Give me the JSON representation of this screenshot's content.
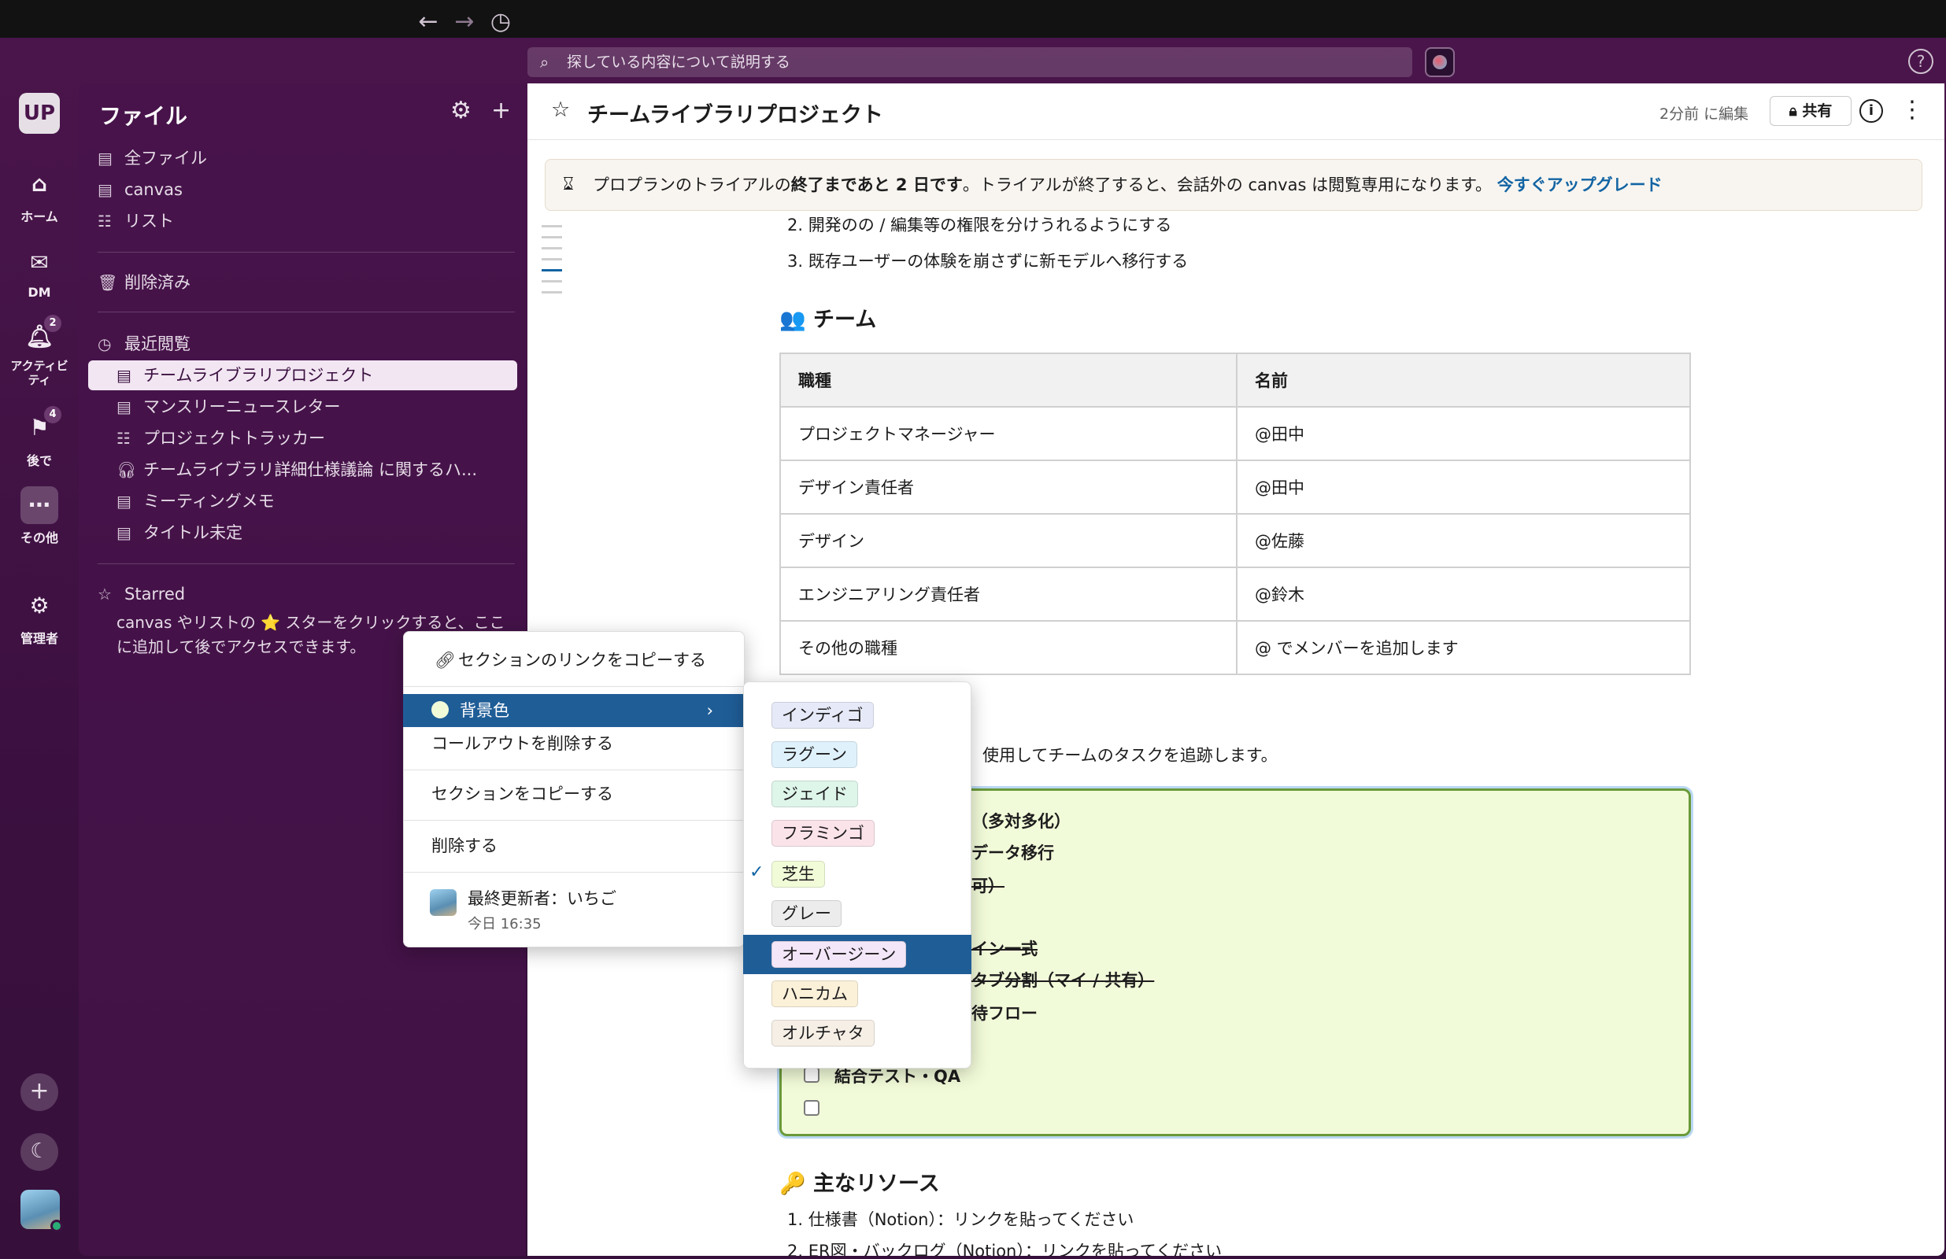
{
  "toolbar": {
    "back_icon": "arrow-left-icon",
    "forward_icon": "arrow-right-icon",
    "history_icon": "clock-icon",
    "search_placeholder": "探している内容について説明する",
    "help_icon": "question-icon"
  },
  "workspace": {
    "initials": "UP"
  },
  "rail": {
    "home": "ホーム",
    "dm": "DM",
    "activity": "アクティビティ",
    "activity_badge": "2",
    "later": "後で",
    "later_badge": "4",
    "more": "その他",
    "admin": "管理者"
  },
  "sidebar": {
    "title": "ファイル",
    "items": [
      {
        "label": "全ファイル",
        "icon": "canvas-icon"
      },
      {
        "label": "canvas",
        "icon": "canvas-icon"
      },
      {
        "label": "リスト",
        "icon": "list-icon"
      }
    ],
    "deleted": "削除済み",
    "recent_heading": "最近閲覧",
    "recent": [
      {
        "label": "チームライブラリプロジェクト",
        "icon": "canvas-icon",
        "selected": true
      },
      {
        "label": "マンスリーニュースレター",
        "icon": "canvas-icon"
      },
      {
        "label": "プロジェクトトラッカー",
        "icon": "list-icon"
      },
      {
        "label": "チームライブラリ詳細仕様議論 に関するハ...",
        "icon": "headphones-icon"
      },
      {
        "label": "ミーティングメモ",
        "icon": "canvas-icon"
      },
      {
        "label": "タイトル未定",
        "icon": "canvas-icon"
      }
    ],
    "starred_heading": "Starred",
    "starred_desc": "canvas やリストの ⭐ スターをクリックすると、ここに追加して後でアクセスできます。"
  },
  "doc": {
    "title": "チームライブラリプロジェクト",
    "edited": "2分前 に編集",
    "share": "共有",
    "banner_pre": "プロプランのトライアルの",
    "banner_bold": "終了まであと 2 日です",
    "banner_post": "。トライアルが終了すると、会話外の canvas は閲覧専用になります。",
    "banner_link": "今すぐアップグレード",
    "partial_item": "2.  開発のの / 編集等の権限を分けうれるようにする",
    "item3": "3.  既存ユーザーの体験を崩さずに新モデルへ移行する",
    "team_heading": "👥 チーム",
    "table_headers": [
      "職種",
      "名前"
    ],
    "table_rows": [
      [
        "プロジェクトマネージャー",
        "@田中"
      ],
      [
        "デザイン責任者",
        "@田中"
      ],
      [
        "デザイン",
        "@佐藤"
      ],
      [
        "エンジニアリング責任者",
        "@鈴木"
      ],
      [
        "その他の職種",
        "@ でメンバーを追加します"
      ]
    ],
    "task_intro": "使用してチームのタスクを追跡します。",
    "tasks": [
      {
        "text": "（多対多化）",
        "strike": false
      },
      {
        "text": "データ移行",
        "strike": false
      },
      {
        "text": "可）",
        "strike": true
      },
      {
        "text": "イン一式",
        "strike": true
      },
      {
        "text": "タブ分割（マイ / 共有）",
        "strike": true
      },
      {
        "text": "待フロー",
        "strike": false
      }
    ],
    "task_qa": "結合テスト・QA",
    "resources_heading": "🔑 主なリソース",
    "res1": "1.  仕様書（Notion）：リンクを貼ってください",
    "res2": "2.  ER図・バックログ（Notion）：リンクを貼ってください"
  },
  "context_menu": {
    "copy_link": "セクションのリンクをコピーする",
    "bg_color": "背景色",
    "remove_callout": "コールアウトを削除する",
    "copy_section": "セクションをコピーする",
    "delete": "削除する",
    "updated_by": "最終更新者：いちご",
    "updated_time": "今日 16:35"
  },
  "color_menu": [
    {
      "label": "インディゴ",
      "color": "#e6eaf8",
      "selected": false,
      "highlighted": false
    },
    {
      "label": "ラグーン",
      "color": "#dff1fb",
      "selected": false,
      "highlighted": false
    },
    {
      "label": "ジェイド",
      "color": "#def5ea",
      "selected": false,
      "highlighted": false
    },
    {
      "label": "フラミンゴ",
      "color": "#fbe3ea",
      "selected": false,
      "highlighted": false
    },
    {
      "label": "芝生",
      "color": "#f1fbd8",
      "selected": true,
      "highlighted": false
    },
    {
      "label": "グレー",
      "color": "#ececec",
      "selected": false,
      "highlighted": false
    },
    {
      "label": "オーバージーン",
      "color": "#f3e6f8",
      "selected": false,
      "highlighted": true
    },
    {
      "label": "ハニカム",
      "color": "#fbf0d8",
      "selected": false,
      "highlighted": false
    },
    {
      "label": "オルチャタ",
      "color": "#f5efe6",
      "selected": false,
      "highlighted": false
    }
  ],
  "colors": {
    "sidebar_bg": "#3f0e40",
    "highlight": "#1f5d97",
    "link": "#1264a3",
    "callout_bg": "#f2fbd9"
  }
}
